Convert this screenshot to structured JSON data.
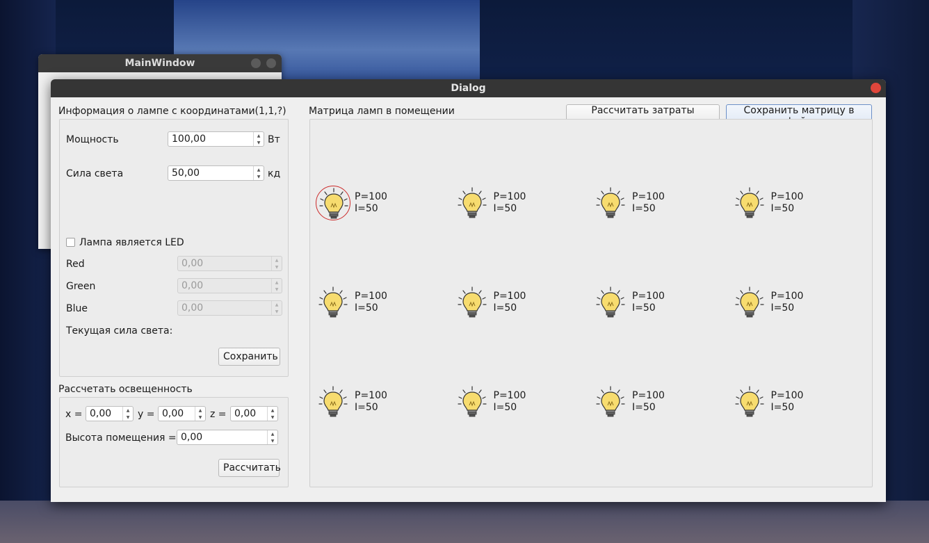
{
  "main_window": {
    "title": "MainWindow"
  },
  "dialog": {
    "title": "Dialog"
  },
  "info_group": {
    "title": "Информация о лампе с координатами(1,1,?)",
    "power_label": "Мощность",
    "power_value": "100,00",
    "power_unit": "Вт",
    "intensity_label": "Сила света",
    "intensity_value": "50,00",
    "intensity_unit": "кд",
    "led_checkbox_label": "Лампа является LED",
    "led_checked": false,
    "red_label": "Red",
    "red_value": "0,00",
    "green_label": "Green",
    "green_value": "0,00",
    "blue_label": "Blue",
    "blue_value": "0,00",
    "current_intensity_label": "Текущая сила света:",
    "save_button": "Сохранить"
  },
  "illumination_group": {
    "title": "Рассчетать освещенность",
    "x_label": "x =",
    "x_value": "0,00",
    "y_label": "y =",
    "y_value": "0,00",
    "z_label": "z =",
    "z_value": "0,00",
    "height_label": "Высота помещения =",
    "height_value": "0,00",
    "calc_button": "Рассчитать"
  },
  "matrix": {
    "title": "Матрица ламп в помещении",
    "calc_power_button": "Рассчитать затраты мощности",
    "save_matrix_button": "Сохранить матрицу в файл",
    "lamps": [
      {
        "p": "P=100",
        "i": "I=50",
        "selected": true
      },
      {
        "p": "P=100",
        "i": "I=50"
      },
      {
        "p": "P=100",
        "i": "I=50"
      },
      {
        "p": "P=100",
        "i": "I=50"
      },
      {
        "p": "P=100",
        "i": "I=50"
      },
      {
        "p": "P=100",
        "i": "I=50"
      },
      {
        "p": "P=100",
        "i": "I=50"
      },
      {
        "p": "P=100",
        "i": "I=50"
      },
      {
        "p": "P=100",
        "i": "I=50"
      },
      {
        "p": "P=100",
        "i": "I=50"
      },
      {
        "p": "P=100",
        "i": "I=50"
      },
      {
        "p": "P=100",
        "i": "I=50"
      }
    ]
  },
  "colors": {
    "accent_selected": "#cc2b2b",
    "bulb": "#f7dc6f",
    "close": "#e0463b"
  }
}
